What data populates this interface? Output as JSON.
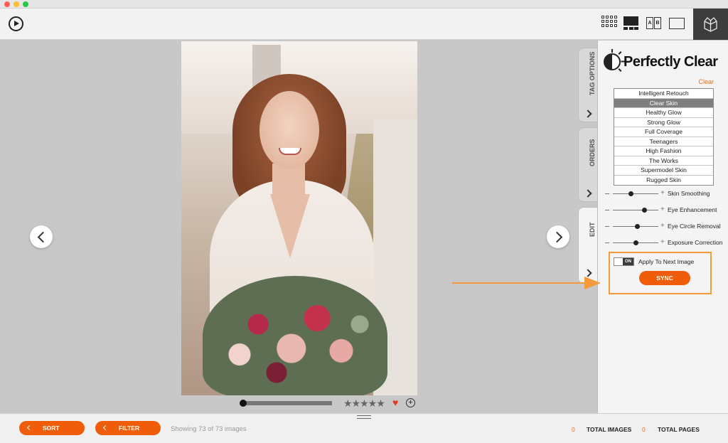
{
  "toolbar": {
    "play": "play-icon",
    "views": [
      "grid-view-icon",
      "loupe-view-icon",
      "compare-view-icon",
      "single-view-icon"
    ],
    "ab_labels": [
      "A",
      "B"
    ],
    "brand_icon": "box-logo-icon"
  },
  "viewer": {
    "rating_stars": "★★★★★",
    "heart": "♥",
    "add": "+"
  },
  "tabs": [
    {
      "label": "TAG OPTIONS"
    },
    {
      "label": "ORDERS"
    },
    {
      "label": "EDIT"
    }
  ],
  "panel": {
    "title": "Perfectly Clear",
    "clear_label": "Clear",
    "presets": [
      "Intelligent Retouch",
      "Clear Skin",
      "Healthy Glow",
      "Strong Glow",
      "Full Coverage",
      "Teenagers",
      "High Fashion",
      "The Works",
      "Supermodel Skin",
      "Rugged Skin"
    ],
    "selected_preset": "Clear Skin",
    "sliders": [
      {
        "label": "Skin Smoothing",
        "value": 0.38
      },
      {
        "label": "Eye Enhancement",
        "value": 0.72
      },
      {
        "label": "Eye Circle Removal",
        "value": 0.55
      },
      {
        "label": "Exposure Correction",
        "value": 0.5
      }
    ],
    "toggle_state": "ON",
    "apply_label": "Apply To Next Image",
    "sync_label": "SYNC"
  },
  "bottom": {
    "sort_label": "SORT",
    "filter_label": "FILTER",
    "showing": "Showing 73 of 73 images",
    "total_images_count": "0",
    "total_images_label": "TOTAL IMAGES",
    "total_pages_count": "0",
    "total_pages_label": "TOTAL PAGES"
  },
  "colors": {
    "accent": "#f05d0a",
    "annotation": "#f39a3a"
  }
}
